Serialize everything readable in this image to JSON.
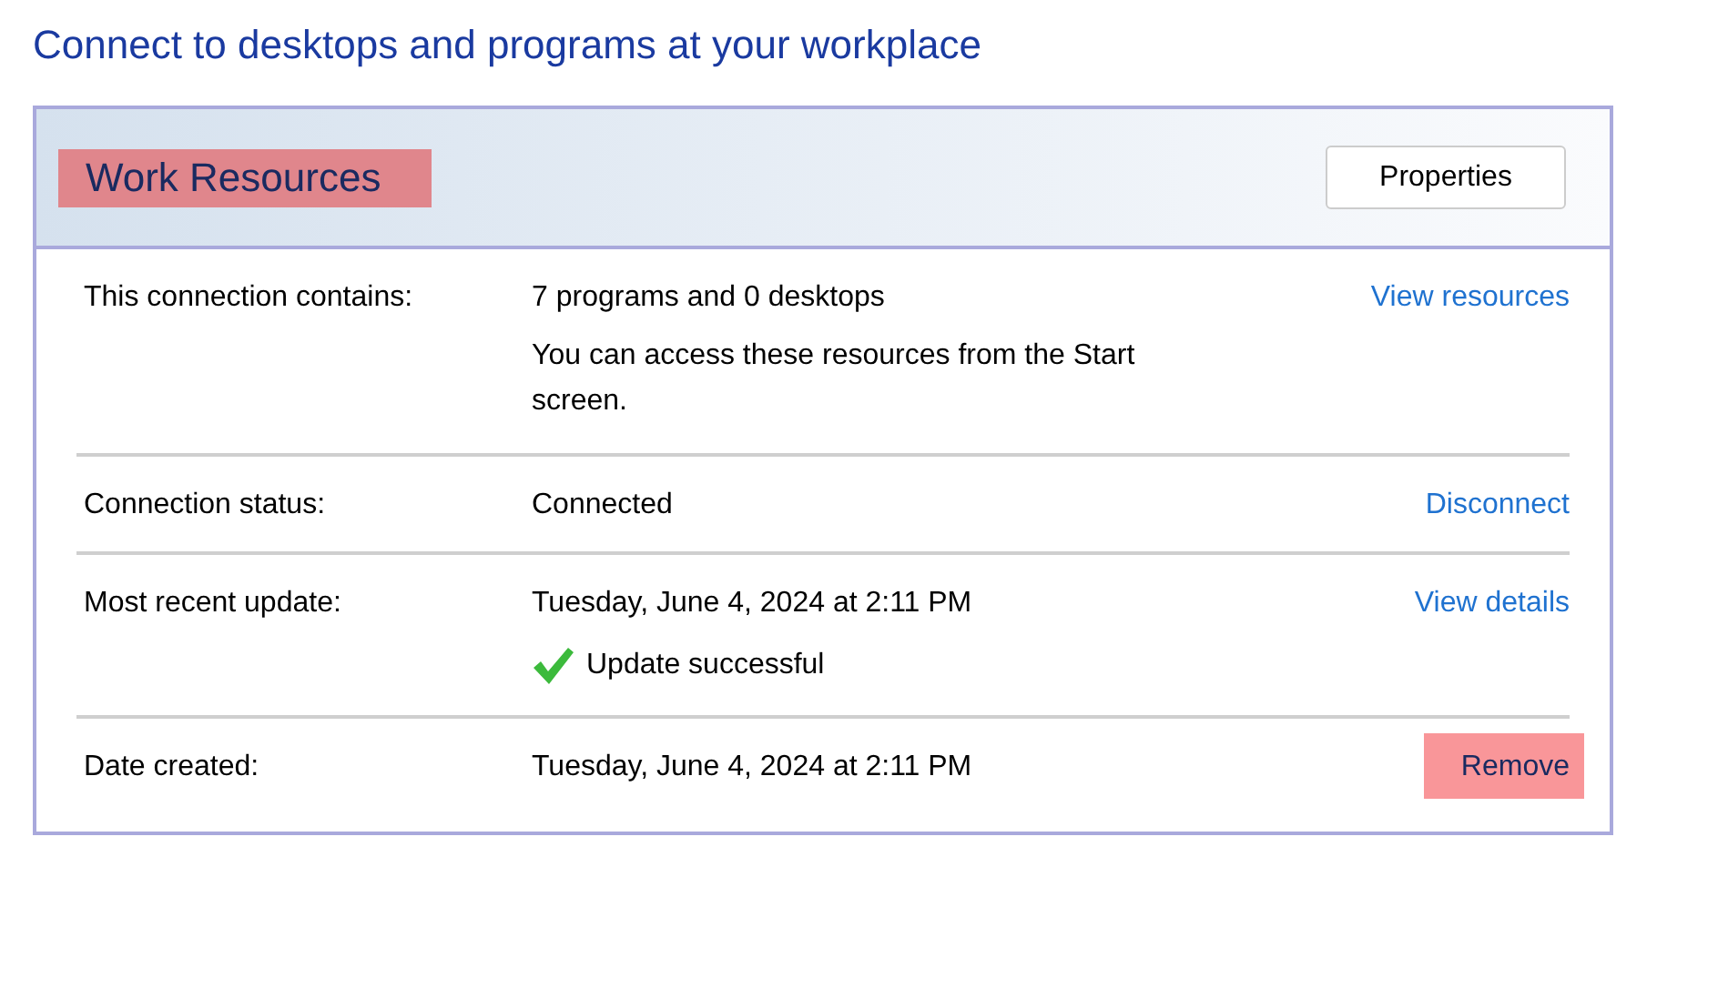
{
  "heading": "Connect to desktops and programs at your workplace",
  "connection": {
    "title": "Work Resources",
    "title_highlighted": true,
    "properties_button": "Properties"
  },
  "rows": [
    {
      "label": "This connection contains:",
      "value": "7 programs and 0 desktops",
      "action": "View resources",
      "action_highlighted": false,
      "extra": {
        "kind": "note",
        "text": "You can access these resources from the Start screen."
      }
    },
    {
      "label": "Connection status:",
      "value": "Connected",
      "action": "Disconnect",
      "action_highlighted": false
    },
    {
      "label": "Most recent update:",
      "value": "Tuesday, June 4, 2024 at 2:11 PM",
      "action": "View details",
      "action_highlighted": false,
      "extra": {
        "kind": "success",
        "text": "Update successful"
      }
    },
    {
      "label": "Date created:",
      "value": "Tuesday, June 4, 2024 at 2:11 PM",
      "action": "Remove",
      "action_highlighted": true
    }
  ]
}
